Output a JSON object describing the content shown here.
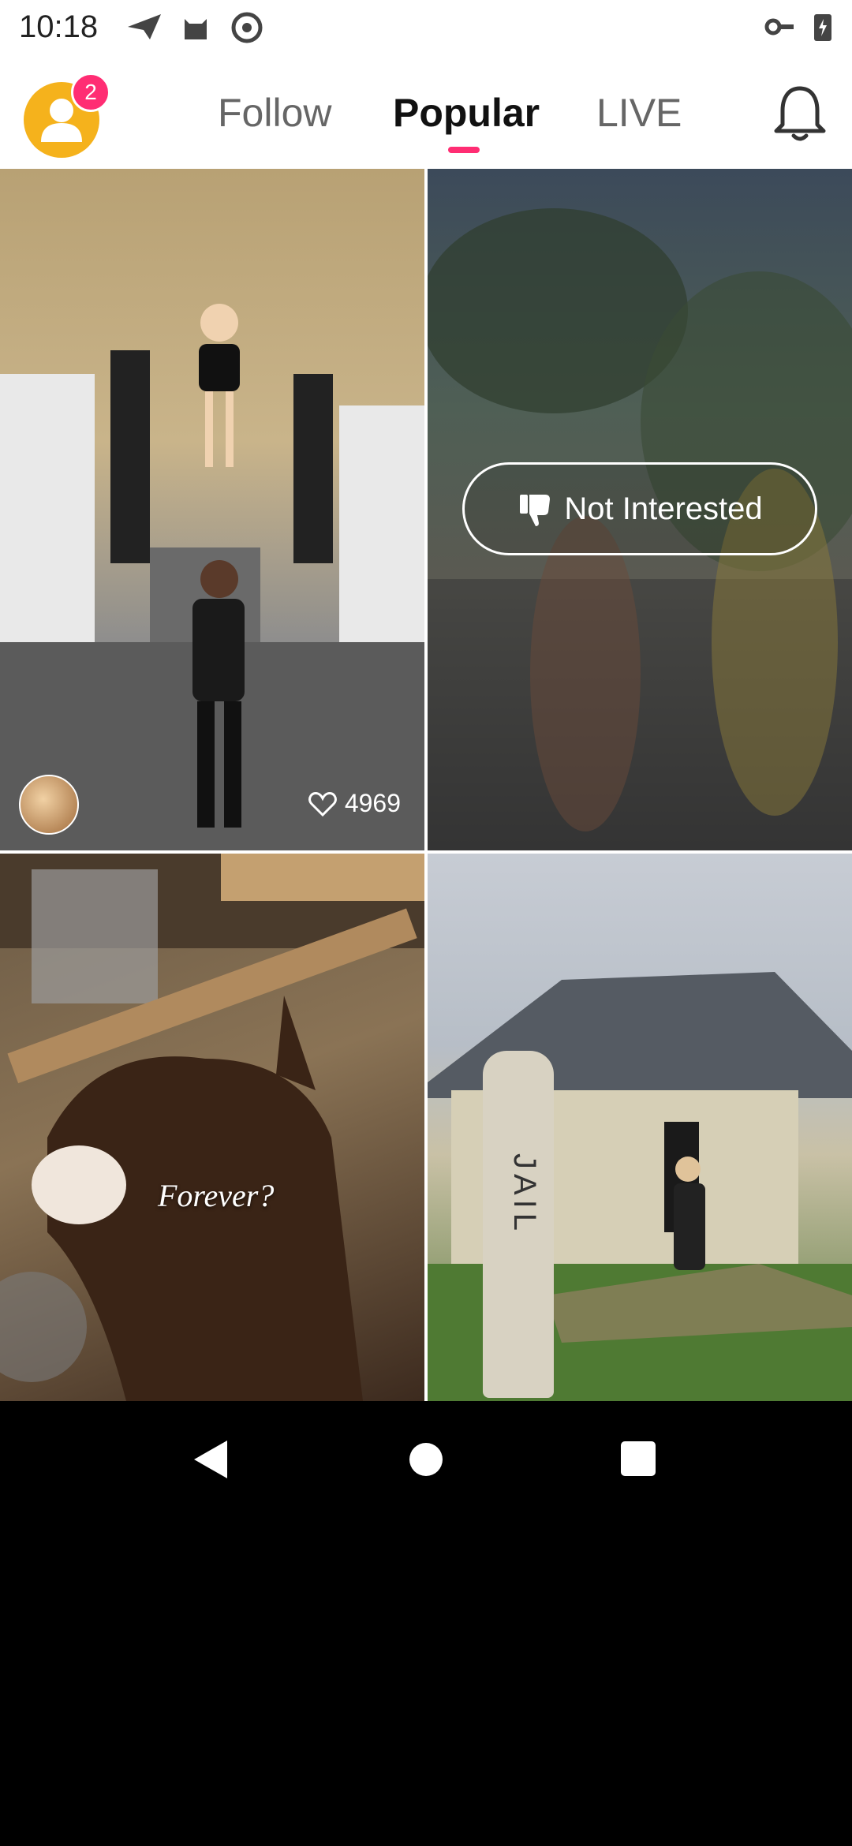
{
  "status_bar": {
    "time": "10:18"
  },
  "header": {
    "avatar_badge": "2",
    "tabs": [
      "Follow",
      "Popular",
      "LIVE"
    ],
    "active_tab": "Popular"
  },
  "feed": {
    "tile1": {
      "likes": "4969"
    },
    "tile2": {
      "not_interested_label": "Not Interested"
    },
    "tile3": {
      "caption": "Forever?"
    },
    "tile4": {
      "post_text": "JAIL"
    }
  },
  "colors": {
    "accent": "#ff2d73",
    "avatar_bg": "#f5b21c"
  },
  "icons": {
    "bottom": [
      "home-icon",
      "record-video-icon",
      "search-icon"
    ],
    "nav": [
      "back-icon",
      "home-nav-icon",
      "recents-icon"
    ]
  }
}
